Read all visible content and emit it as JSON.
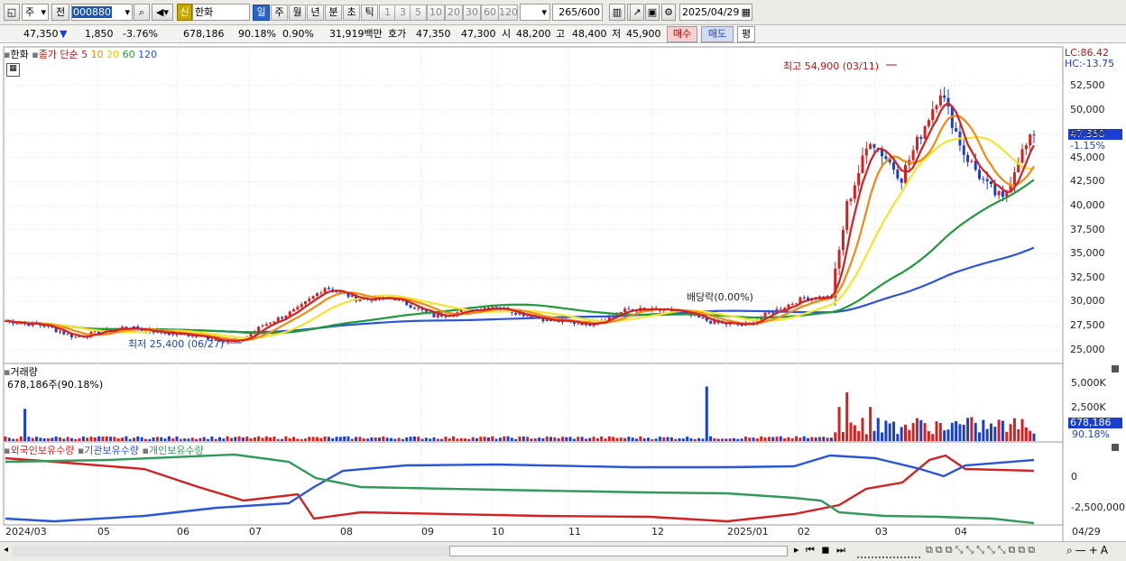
{
  "toolbar": {
    "market": "주",
    "type": "전",
    "code": "000880",
    "new_badge": "신",
    "stock_name": "한화",
    "periods": [
      "일",
      "주",
      "월",
      "년",
      "분",
      "초",
      "틱"
    ],
    "active_period": "일",
    "minutes": [
      "1",
      "3",
      "5",
      "10",
      "20",
      "30",
      "60",
      "120"
    ],
    "count": "265",
    "count_max": "/600",
    "date": "2025/04/29"
  },
  "quote": {
    "price": "47,350",
    "down_arrow": "▼",
    "change": "1,850",
    "change_pct": "-3.76%",
    "volume": "678,186",
    "volume_ratio": "90.18%",
    "turnover_pct": "0.90%",
    "amount": "31,919백만",
    "ask_label": "호가",
    "ask1": "47,350",
    "ask2": "47,300",
    "open_label": "시",
    "open": "48,200",
    "high_label": "고",
    "high": "48,400",
    "low_label": "저",
    "low": "45,900",
    "buy": "매수",
    "sell": "매도",
    "eval": "평"
  },
  "price_panel": {
    "name": "한화",
    "ma_title": "종가 단순",
    "ma_periods": [
      "5",
      "10",
      "20",
      "60",
      "120"
    ],
    "lc": "LC:86.42",
    "hc": "HC:-13.75",
    "max_label": "최고 54,900 (03/11)",
    "min_label": "최저 25,400 (06/27)",
    "dividend_label": "배당락(0.00%)",
    "current_price": "47,350",
    "current_pct": "-1.15%",
    "y_ticks": [
      "52,500",
      "50,000",
      "47,500",
      "45,000",
      "42,500",
      "40,000",
      "37,500",
      "35,000",
      "32,500",
      "30,000",
      "27,500",
      "25,000"
    ]
  },
  "volume_panel": {
    "title": "거래량",
    "value": "678,186주(90.18%)",
    "y_ticks": [
      "5,000K",
      "2,500K"
    ],
    "current": "678,186",
    "current_pct": "90.18%"
  },
  "holding_panel": {
    "legend": [
      "외국인보유수량",
      "기관보유수량",
      "개인보유수량"
    ],
    "y_ticks": [
      "0",
      "-2,500,000"
    ]
  },
  "x_axis": [
    "2024/03",
    "05",
    "06",
    "07",
    "08",
    "09",
    "10",
    "11",
    "12",
    "2025/01",
    "02",
    "03",
    "04"
  ],
  "x_axis_end": "04/29",
  "colors": {
    "up": "#d42020",
    "down": "#1a3fd0",
    "ma5": "#d42020",
    "ma10": "#f08a10",
    "ma20": "#f2e52a",
    "ma60": "#1f9a3a",
    "ma120": "#2a55d8",
    "foreign": "#d42020",
    "institution": "#2a55d8",
    "individual": "#2f9a5a"
  }
}
